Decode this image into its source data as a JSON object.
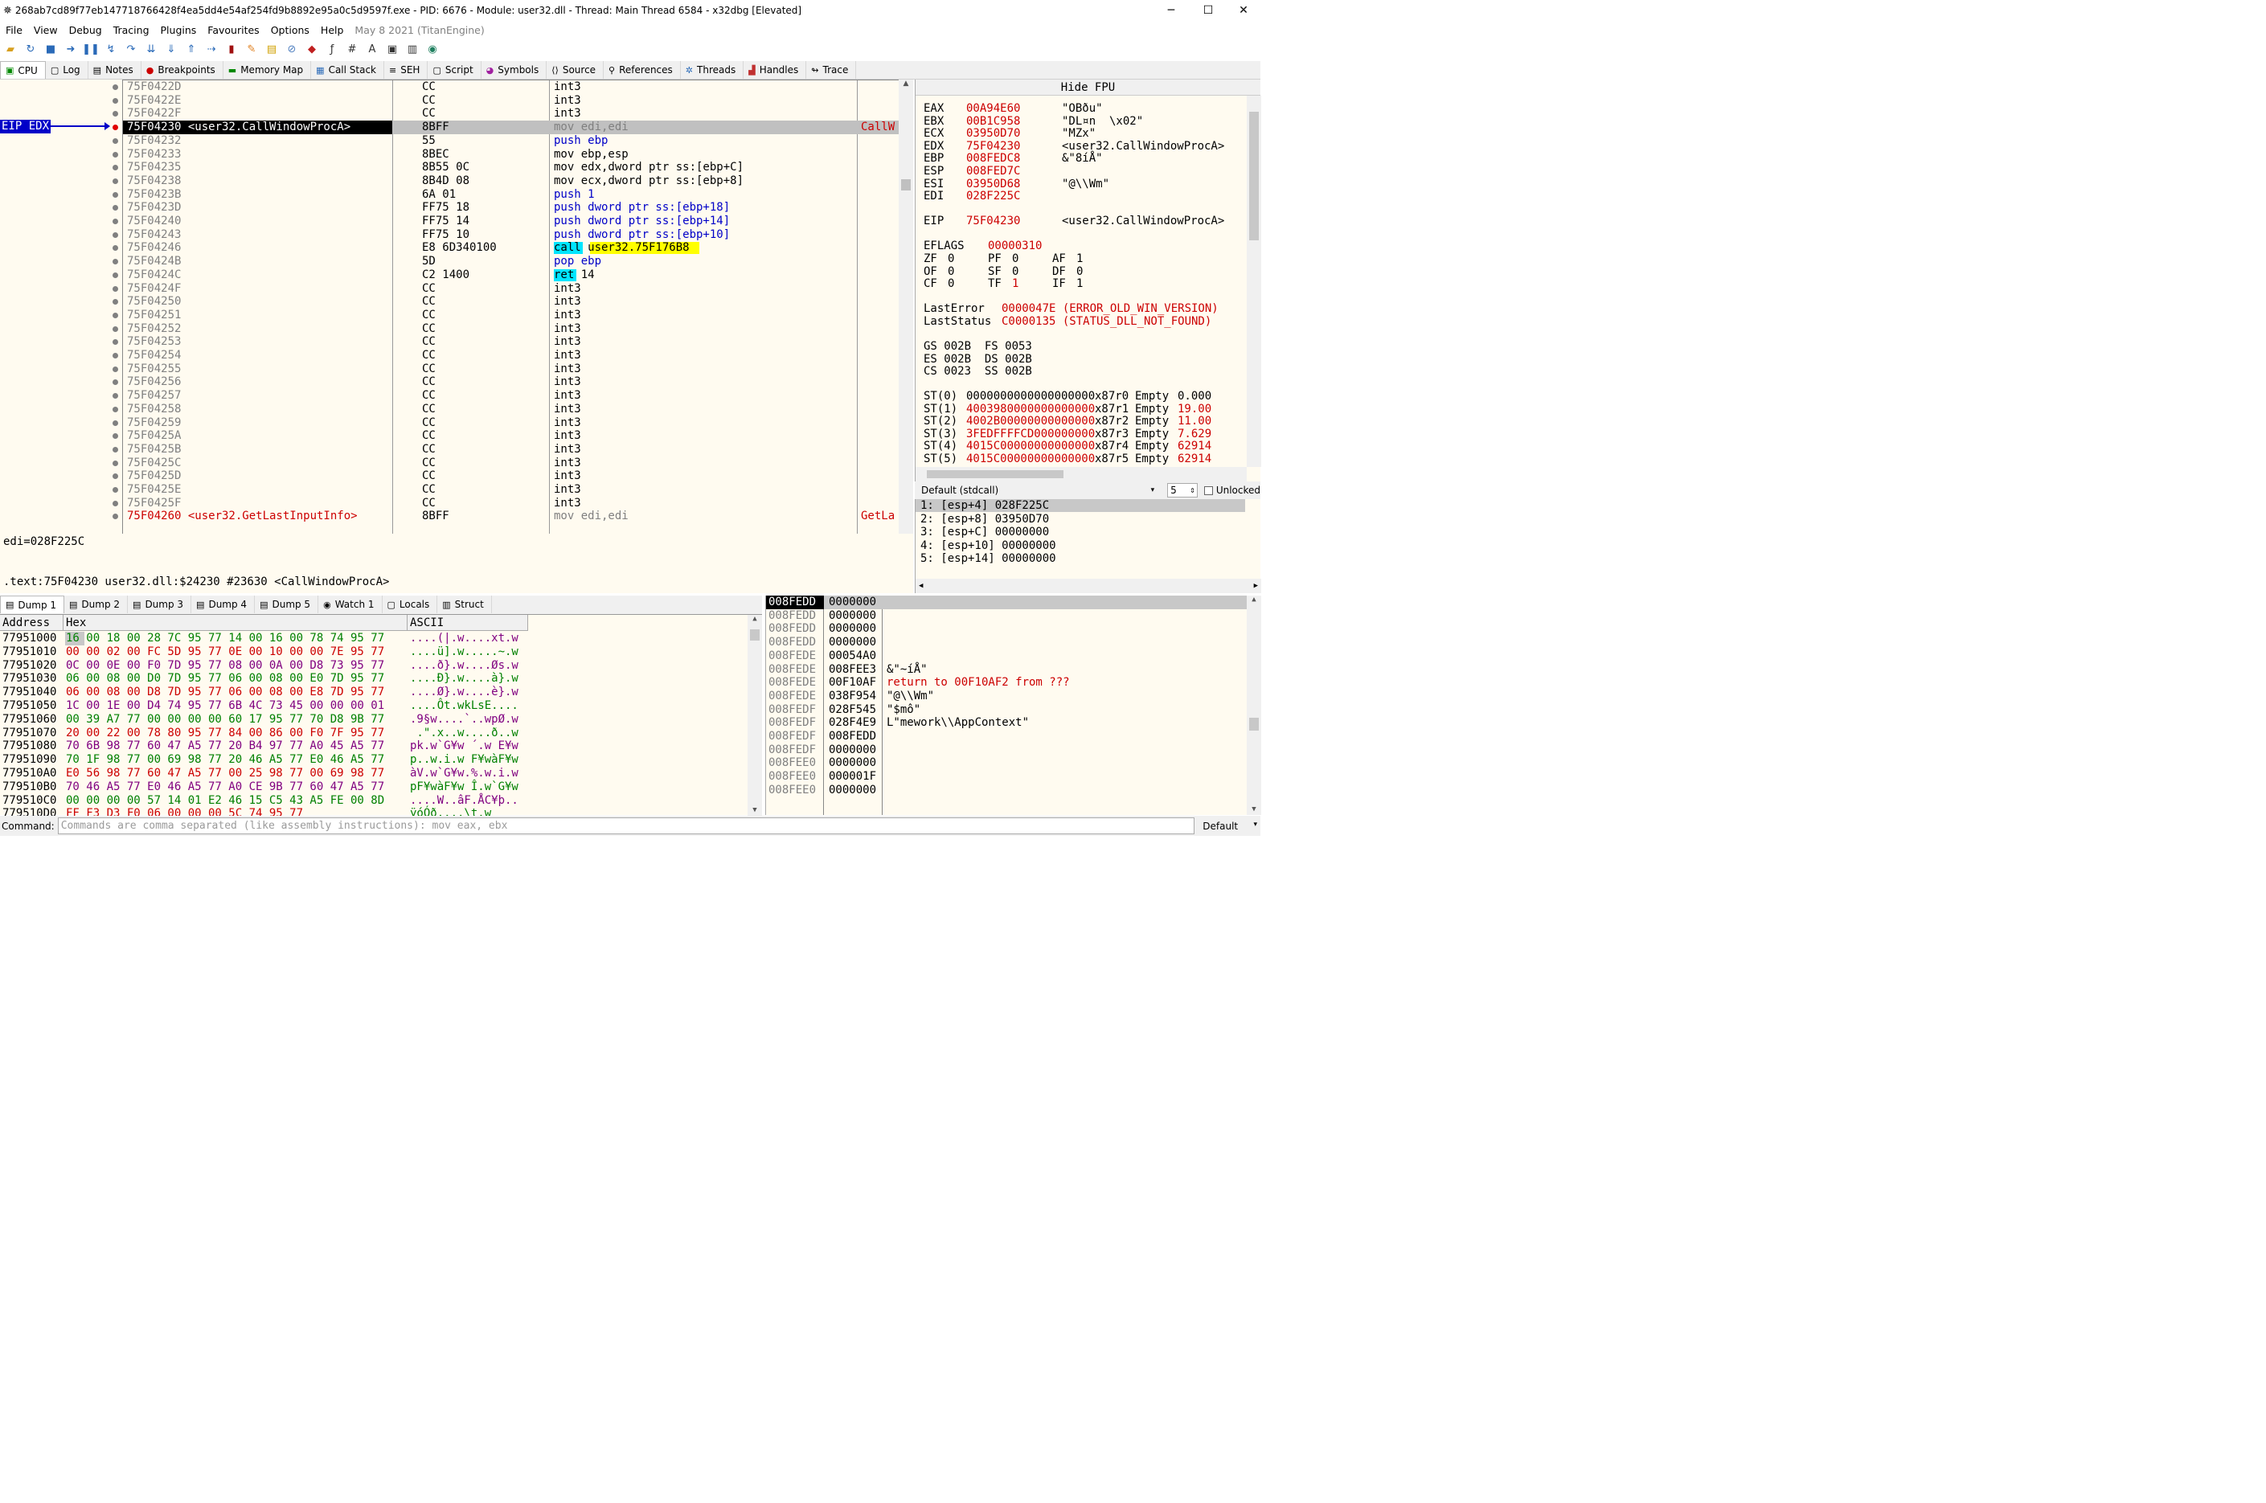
{
  "title": "268ab7cd89f77eb147718766428f4ea5dd4e54af254fd9b8892e95a0c5d9597f.exe - PID: 6676 - Module: user32.dll - Thread: Main Thread 6584 - x32dbg [Elevated]",
  "window_controls": {
    "minimize": "─",
    "maximize": "☐",
    "close": "✕"
  },
  "menu": [
    "File",
    "View",
    "Debug",
    "Tracing",
    "Plugins",
    "Favourites",
    "Options",
    "Help"
  ],
  "build_info": "May 8 2021 (TitanEngine)",
  "tabs": [
    "CPU",
    "Log",
    "Notes",
    "Breakpoints",
    "Memory Map",
    "Call Stack",
    "SEH",
    "Script",
    "Symbols",
    "Source",
    "References",
    "Threads",
    "Handles",
    "Trace"
  ],
  "eip_label": "EIP EDX",
  "disasm": [
    {
      "addr": "75F0422D",
      "bytes": "CC",
      "instr": "int3",
      "comment": ""
    },
    {
      "addr": "75F0422E",
      "bytes": "CC",
      "instr": "int3",
      "comment": ""
    },
    {
      "addr": "75F0422F",
      "bytes": "CC",
      "instr": "int3",
      "comment": ""
    },
    {
      "addr": "75F04230 <user32.CallWindowProcA>",
      "bytes": "8BFF",
      "instr": "mov edi,edi",
      "comment": "CallW"
    },
    {
      "addr": "75F04232",
      "bytes": "55",
      "instr": "push ebp",
      "comment": ""
    },
    {
      "addr": "75F04233",
      "bytes": "8BEC",
      "instr": "mov ebp,esp",
      "comment": ""
    },
    {
      "addr": "75F04235",
      "bytes": "8B55 0C",
      "instr": "mov edx,dword ptr ss:[ebp+C]",
      "comment": ""
    },
    {
      "addr": "75F04238",
      "bytes": "8B4D 08",
      "instr": "mov ecx,dword ptr ss:[ebp+8]",
      "comment": ""
    },
    {
      "addr": "75F0423B",
      "bytes": "6A 01",
      "instr": "push 1",
      "comment": ""
    },
    {
      "addr": "75F0423D",
      "bytes": "FF75 18",
      "instr": "push dword ptr ss:[ebp+18]",
      "comment": ""
    },
    {
      "addr": "75F04240",
      "bytes": "FF75 14",
      "instr": "push dword ptr ss:[ebp+14]",
      "comment": ""
    },
    {
      "addr": "75F04243",
      "bytes": "FF75 10",
      "instr": "push dword ptr ss:[ebp+10]",
      "comment": ""
    },
    {
      "addr": "75F04246",
      "bytes": "E8 6D340100",
      "instr": "call user32.75F176B8",
      "comment": ""
    },
    {
      "addr": "75F0424B",
      "bytes": "5D",
      "instr": "pop ebp",
      "comment": ""
    },
    {
      "addr": "75F0424C",
      "bytes": "C2 1400",
      "instr": "ret 14",
      "comment": ""
    },
    {
      "addr": "75F0424F",
      "bytes": "CC",
      "instr": "int3",
      "comment": ""
    },
    {
      "addr": "75F04250",
      "bytes": "CC",
      "instr": "int3",
      "comment": ""
    },
    {
      "addr": "75F04251",
      "bytes": "CC",
      "instr": "int3",
      "comment": ""
    },
    {
      "addr": "75F04252",
      "bytes": "CC",
      "instr": "int3",
      "comment": ""
    },
    {
      "addr": "75F04253",
      "bytes": "CC",
      "instr": "int3",
      "comment": ""
    },
    {
      "addr": "75F04254",
      "bytes": "CC",
      "instr": "int3",
      "comment": ""
    },
    {
      "addr": "75F04255",
      "bytes": "CC",
      "instr": "int3",
      "comment": ""
    },
    {
      "addr": "75F04256",
      "bytes": "CC",
      "instr": "int3",
      "comment": ""
    },
    {
      "addr": "75F04257",
      "bytes": "CC",
      "instr": "int3",
      "comment": ""
    },
    {
      "addr": "75F04258",
      "bytes": "CC",
      "instr": "int3",
      "comment": ""
    },
    {
      "addr": "75F04259",
      "bytes": "CC",
      "instr": "int3",
      "comment": ""
    },
    {
      "addr": "75F0425A",
      "bytes": "CC",
      "instr": "int3",
      "comment": ""
    },
    {
      "addr": "75F0425B",
      "bytes": "CC",
      "instr": "int3",
      "comment": ""
    },
    {
      "addr": "75F0425C",
      "bytes": "CC",
      "instr": "int3",
      "comment": ""
    },
    {
      "addr": "75F0425D",
      "bytes": "CC",
      "instr": "int3",
      "comment": ""
    },
    {
      "addr": "75F0425E",
      "bytes": "CC",
      "instr": "int3",
      "comment": ""
    },
    {
      "addr": "75F0425F",
      "bytes": "CC",
      "instr": "int3",
      "comment": ""
    },
    {
      "addr": "75F04260 <user32.GetLastInputInfo>",
      "bytes": "8BFF",
      "instr": "mov edi,edi",
      "comment": "GetLa"
    }
  ],
  "info": {
    "line1": "edi=028F225C",
    "line2": ".text:75F04230 user32.dll:$24230 #23630 <CallWindowProcA>"
  },
  "fpu_header": "Hide FPU",
  "registers": [
    {
      "name": "EAX",
      "value": "00A94E60",
      "comment": "\"OBðu\""
    },
    {
      "name": "EBX",
      "value": "00B1C958",
      "comment": "\"DL¤n  \\x02\""
    },
    {
      "name": "ECX",
      "value": "03950D70",
      "comment": "\"MZx\""
    },
    {
      "name": "EDX",
      "value": "75F04230",
      "comment": "<user32.CallWindowProcA>"
    },
    {
      "name": "EBP",
      "value": "008FEDC8",
      "comment": "&\"8íÅ\""
    },
    {
      "name": "ESP",
      "value": "008FED7C",
      "comment": ""
    },
    {
      "name": "ESI",
      "value": "03950D68",
      "comment": "\"@\\\\Wm\""
    },
    {
      "name": "EDI",
      "value": "028F225C",
      "comment": ""
    }
  ],
  "eip": {
    "name": "EIP",
    "value": "75F04230",
    "comment": "<user32.CallWindowProcA>"
  },
  "eflags": {
    "name": "EFLAGS",
    "value": "00000310"
  },
  "flags": [
    "ZF",
    "0",
    "PF",
    "0",
    "AF",
    "1",
    "OF",
    "0",
    "SF",
    "0",
    "DF",
    "0",
    "CF",
    "0",
    "TF",
    "1",
    "IF",
    "1"
  ],
  "lasterror": {
    "label": "LastError",
    "value": "0000047E (ERROR_OLD_WIN_VERSION)"
  },
  "laststatus": {
    "label": "LastStatus",
    "value": "C0000135 (STATUS_DLL_NOT_FOUND)"
  },
  "segs": [
    "GS 002B  FS 0053",
    "ES 002B  DS 002B",
    "CS 0023  SS 002B"
  ],
  "fpu": [
    {
      "n": "ST(0)",
      "v": "0000000000000000000",
      "r": "x87r0",
      "t": "Empty",
      "x": "0.000"
    },
    {
      "n": "ST(1)",
      "v": "4003980000000000000",
      "r": "x87r1",
      "t": "Empty",
      "x": "19.00"
    },
    {
      "n": "ST(2)",
      "v": "4002B00000000000000",
      "r": "x87r2",
      "t": "Empty",
      "x": "11.00"
    },
    {
      "n": "ST(3)",
      "v": "3FEDFFFFCD000000000",
      "r": "x87r3",
      "t": "Empty",
      "x": "7.629"
    },
    {
      "n": "ST(4)",
      "v": "4015C00000000000000",
      "r": "x87r4",
      "t": "Empty",
      "x": "62914"
    },
    {
      "n": "ST(5)",
      "v": "4015C00000000000000",
      "r": "x87r5",
      "t": "Empty",
      "x": "62914"
    }
  ],
  "callconv": {
    "value": "Default (stdcall)",
    "count": "5",
    "unlocked": "Unlocked"
  },
  "stackargs": [
    "1: [esp+4] 028F225C",
    "2: [esp+8] 03950D70",
    "3: [esp+C] 00000000",
    "4: [esp+10] 00000000",
    "5: [esp+14] 00000000"
  ],
  "dumptabs": [
    "Dump 1",
    "Dump 2",
    "Dump 3",
    "Dump 4",
    "Dump 5",
    "Watch 1",
    "Locals",
    "Struct"
  ],
  "dump_headers": {
    "address": "Address",
    "hex": "Hex",
    "ascii": "ASCII"
  },
  "dump": [
    {
      "a": "77951000",
      "h": "16 00 18 00 28 7C 95 77 14 00 16 00 78 74 95 77",
      "s": "....(|.w....xt.w"
    },
    {
      "a": "77951010",
      "h": "00 00 02 00 FC 5D 95 77 0E 00 10 00 00 7E 95 77",
      "s": "....ü].w.....~.w"
    },
    {
      "a": "77951020",
      "h": "0C 00 0E 00 F0 7D 95 77 08 00 0A 00 D8 73 95 77",
      "s": "....ð}.w....Øs.w"
    },
    {
      "a": "77951030",
      "h": "06 00 08 00 D0 7D 95 77 06 00 08 00 E0 7D 95 77",
      "s": "....Ð}.w....à}.w"
    },
    {
      "a": "77951040",
      "h": "06 00 08 00 D8 7D 95 77 06 00 08 00 E8 7D 95 77",
      "s": "....Ø}.w....è}.w"
    },
    {
      "a": "77951050",
      "h": "1C 00 1E 00 D4 74 95 77 6B 4C 73 45 00 00 00 01",
      "s": "....Ôt.wkLsE...."
    },
    {
      "a": "77951060",
      "h": "00 39 A7 77 00 00 00 00 60 17 95 77 70 D8 9B 77",
      "s": ".9§w....`..wpØ.w"
    },
    {
      "a": "77951070",
      "h": "20 00 22 00 78 80 95 77 84 00 86 00 F0 7F 95 77",
      "s": " .\".x..w....ð..w"
    },
    {
      "a": "77951080",
      "h": "70 6B 98 77 60 47 A5 77 20 B4 97 77 A0 45 A5 77",
      "s": "pk.w`G¥w ´.w E¥w"
    },
    {
      "a": "77951090",
      "h": "70 1F 98 77 00 69 98 77 20 46 A5 77 E0 46 A5 77",
      "s": "p..w.i.w F¥wàF¥w"
    },
    {
      "a": "779510A0",
      "h": "E0 56 98 77 60 47 A5 77 00 25 98 77 00 69 98 77",
      "s": "àV.w`G¥w.%.w.i.w"
    },
    {
      "a": "779510B0",
      "h": "70 46 A5 77 E0 46 A5 77 A0 CE 9B 77 60 47 A5 77",
      "s": "pF¥wàF¥w Î.w`G¥w"
    },
    {
      "a": "779510C0",
      "h": "00 00 00 00 57 14 01 E2 46 15 C5 43 A5 FE 00 8D",
      "s": "....W..âF.ÅC¥þ.."
    },
    {
      "a": "779510D0",
      "h": "FF F3 D3 F0 06 00 00 00 5C 74 95 77",
      "s": "ÿóÓð....\\t.w"
    }
  ],
  "stack": [
    {
      "a": "008FEDD",
      "v": "0000000",
      "c": ""
    },
    {
      "a": "008FEDD",
      "v": "0000000",
      "c": ""
    },
    {
      "a": "008FEDD",
      "v": "0000000",
      "c": ""
    },
    {
      "a": "008FEDD",
      "v": "0000000",
      "c": ""
    },
    {
      "a": "008FEDE",
      "v": "00054A0",
      "c": ""
    },
    {
      "a": "008FEDE",
      "v": "008FEE3",
      "c": "&\"~íÅ\""
    },
    {
      "a": "008FEDE",
      "v": "00F10AF",
      "c": "return to 00F10AF2 from ???"
    },
    {
      "a": "008FEDE",
      "v": "038F954",
      "c": "\"@\\\\Wm\""
    },
    {
      "a": "008FEDF",
      "v": "028F545",
      "c": "\"$mô\""
    },
    {
      "a": "008FEDF",
      "v": "028F4E9",
      "c": "L\"mework\\\\AppContext\""
    },
    {
      "a": "008FEDF",
      "v": "008FEDD",
      "c": ""
    },
    {
      "a": "008FEDF",
      "v": "0000000",
      "c": ""
    },
    {
      "a": "008FEE0",
      "v": "0000000",
      "c": ""
    },
    {
      "a": "008FEE0",
      "v": "000001F",
      "c": ""
    },
    {
      "a": "008FEE0",
      "v": "0000000",
      "c": ""
    }
  ],
  "command": {
    "label": "Command:",
    "placeholder": "Commands are comma separated (like assembly instructions): mov eax, ebx",
    "mode": "Default"
  }
}
